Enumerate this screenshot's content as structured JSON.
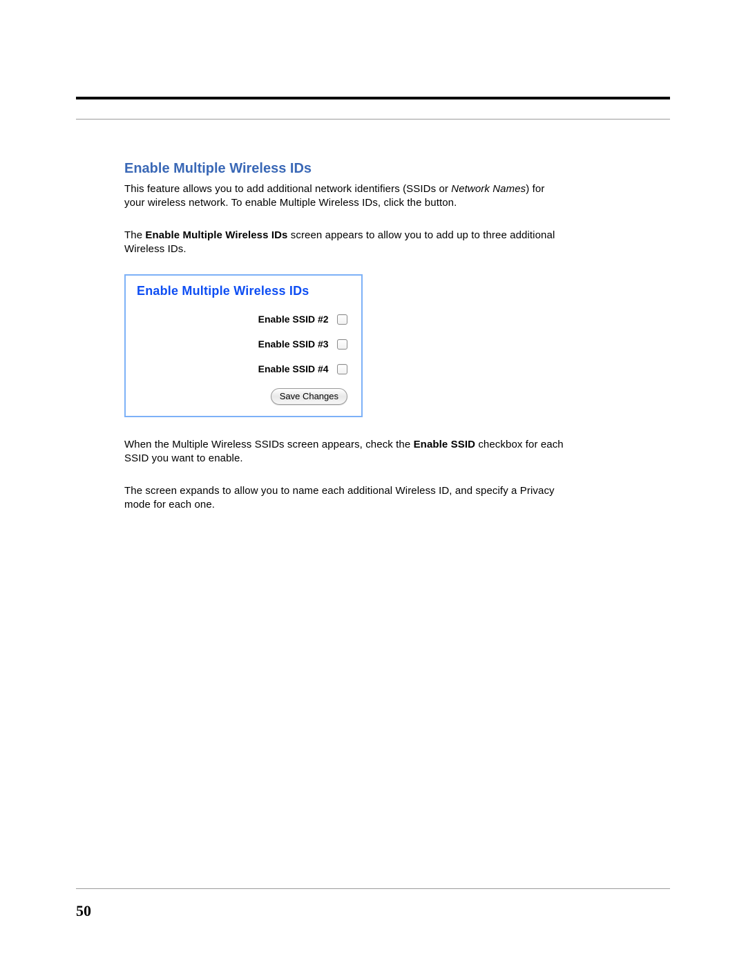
{
  "heading": "Enable Multiple Wireless IDs",
  "para1_a": "This feature allows you to add additional network identifiers (SSIDs or ",
  "para1_italic": "Network Names",
  "para1_b": ") for your wireless network. To enable Multiple Wireless IDs, click the button.",
  "para2_a": "The ",
  "para2_bold": "Enable Multiple Wireless IDs",
  "para2_b": " screen appears to allow you to add up to three additional Wireless IDs.",
  "panel": {
    "title": "Enable Multiple Wireless IDs",
    "ssid2": "Enable SSID #2",
    "ssid3": "Enable SSID #3",
    "ssid4": "Enable SSID #4",
    "save_button": "Save Changes"
  },
  "para3_a": "When the Multiple Wireless SSIDs screen appears, check the ",
  "para3_bold": "Enable SSID",
  "para3_b": " checkbox for each SSID you want to enable.",
  "para4": "The screen expands to allow you to name each additional Wireless ID, and specify a Privacy mode for each one.",
  "page_number": "50"
}
